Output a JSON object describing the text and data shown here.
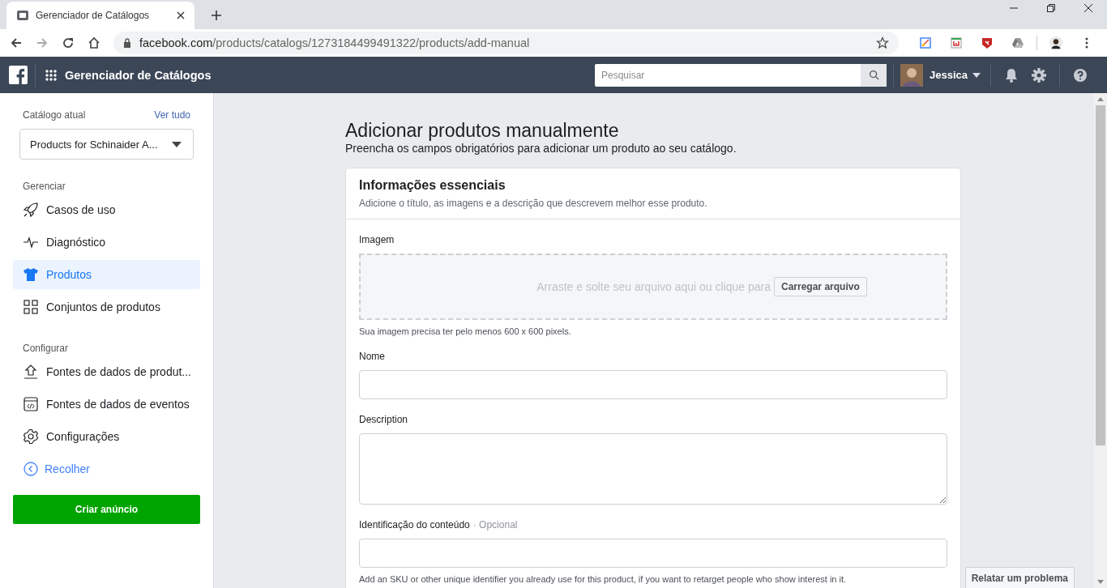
{
  "browser": {
    "tab": {
      "title": "Gerenciador de Catálogos"
    },
    "url": {
      "host": "facebook.com",
      "path": "/products/catalogs/1273184499491322/products/add-manual"
    }
  },
  "header": {
    "app_title": "Gerenciador de Catálogos",
    "search": {
      "placeholder": "Pesquisar"
    },
    "user": {
      "name": "Jessica"
    }
  },
  "sidebar": {
    "catalog_label": "Catálogo atual",
    "see_all": "Ver tudo",
    "catalog": "Products for Schinaider A...",
    "sections": [
      {
        "title": "Gerenciar",
        "items": [
          {
            "label": "Casos de uso",
            "selected": false
          },
          {
            "label": "Diagnóstico",
            "selected": false
          },
          {
            "label": "Produtos",
            "selected": true
          },
          {
            "label": "Conjuntos de produtos",
            "selected": false
          }
        ]
      },
      {
        "title": "Configurar",
        "items": [
          {
            "label": "Fontes de dados de produt...",
            "selected": false
          },
          {
            "label": "Fontes de dados de eventos",
            "selected": false
          },
          {
            "label": "Configurações",
            "selected": false
          }
        ]
      }
    ],
    "collapse": "Recolher",
    "create_ad": "Criar anúncio"
  },
  "page": {
    "title": "Adicionar produtos manualmente",
    "subtitle": "Preencha os campos obrigatórios para adicionar um produto ao seu catálogo.",
    "card": {
      "title": "Informações essenciais",
      "subtitle": "Adicione o título, as imagens e a descrição que descrevem melhor esse produto.",
      "fields": [
        {
          "kind": "upload",
          "label": "Imagem",
          "drop_text": "Arraste e solte seu arquivo aqui ou clique para",
          "button": "Carregar arquivo",
          "hint": "Sua imagem precisa ter pelo menos 600 x 600 pixels."
        },
        {
          "kind": "text",
          "label": "Nome"
        },
        {
          "kind": "textarea",
          "label": "Description"
        },
        {
          "kind": "text",
          "label": "Identificação do conteúdo",
          "optional": "· Opcional",
          "hint": "Add an SKU or other unique identifier you already use for this product, if you want to retarget people who show interest in it."
        }
      ]
    }
  },
  "report_button": "Relatar um problema"
}
